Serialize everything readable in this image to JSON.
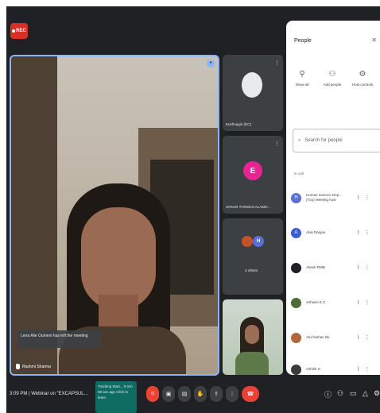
{
  "recording_badge": "REC",
  "main_video": {
    "caption_text": "Lena Alle Oumeni has left the meeting",
    "participant_name": "Rashmi Sharma"
  },
  "tiles": [
    {
      "label": "Krishnagiri (DC)",
      "initial": ""
    },
    {
      "label": "SAKUR THOMAS ALAMO...",
      "initial": "E",
      "color": "#e52592"
    },
    {
      "label": "3 others",
      "initial": "H",
      "color": "#5b6fd8"
    }
  ],
  "people_panel": {
    "title": "People",
    "actions": [
      {
        "icon": "person-add-icon",
        "label": "Show all"
      },
      {
        "icon": "add-people-icon",
        "label": "Add people"
      },
      {
        "icon": "host-controls-icon",
        "label": "Host controls"
      }
    ],
    "search_placeholder": "Search for people",
    "section_label": "In call",
    "participants": [
      {
        "name": "Human Science Dep... (You) Meeting host",
        "initial": "H",
        "color": "#5b6fd8"
      },
      {
        "name": "Alok Ranjan",
        "initial": "A",
        "color": "#3c5bd6"
      },
      {
        "name": "Akash RMB",
        "initial": "",
        "color": "#202124"
      },
      {
        "name": "Ashwini K C",
        "initial": "",
        "color": "#4f6b3a"
      },
      {
        "name": "Atul Mohan Dk",
        "initial": "",
        "color": "#b0683a"
      },
      {
        "name": "Ashish S",
        "initial": "",
        "color": "#3b3b3b"
      }
    ]
  },
  "bottom_bar": {
    "time_and_meeting": "3:09 PM  |  Webinar on \"EXCAPSUL...",
    "notice": "Tracking Start... 9 min 59 sec ago Click to learn"
  }
}
